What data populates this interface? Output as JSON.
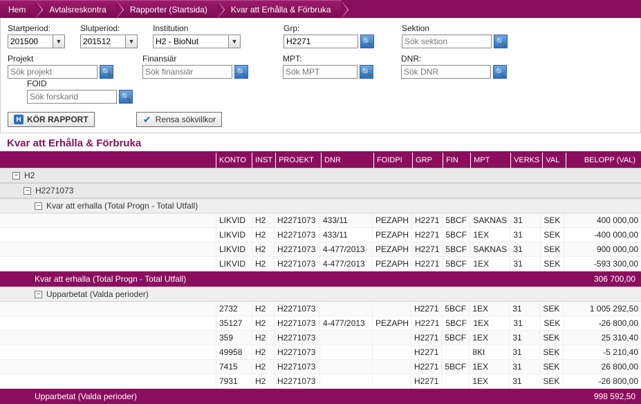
{
  "breadcrumb": [
    "Hem",
    "Avtalsreskontra",
    "Rapporter (Startsida)",
    "Kvar att Erhålla & Förbruka"
  ],
  "filters": {
    "startperiod": {
      "label": "Startperiod:",
      "value": "201500"
    },
    "slutperiod": {
      "label": "Slutperiod:",
      "value": "201512"
    },
    "institution": {
      "label": "Institution",
      "value": "H2 - BioNut"
    },
    "grp": {
      "label": "Grp:",
      "value": "H2271"
    },
    "sektion": {
      "label": "Sektion",
      "placeholder": "Sök sektion",
      "value": ""
    },
    "projekt": {
      "label": "Projekt",
      "placeholder": "Sök projekt",
      "value": ""
    },
    "finansiar": {
      "label": "Finansiär",
      "placeholder": "Sök finansiär",
      "value": ""
    },
    "mpt": {
      "label": "MPT:",
      "placeholder": "Sök MPT",
      "value": ""
    },
    "dnr": {
      "label": "DNR:",
      "placeholder": "Sök DNR",
      "value": ""
    },
    "foid": {
      "label": "FOID",
      "placeholder": "Sök forskarid",
      "value": ""
    }
  },
  "buttons": {
    "run": "KÖR RAPPORT",
    "clear": "Rensa sökvillkor"
  },
  "report_title": "Kvar att Erhålla & Förbruka",
  "columns": {
    "konto": "KONTO",
    "inst": "INST",
    "projekt": "PROJEKT",
    "dnr": "DNR",
    "foidpi": "FOIDPI",
    "grp": "GRP",
    "fin": "FIN",
    "mpt": "MPT",
    "verks": "VERKS",
    "val": "VAL",
    "belopp": "BELOPP (VAL)"
  },
  "groups": {
    "g0": "H2",
    "g1": "H2271073",
    "g2a": "Kvar att erhalla (Total Progn - Total Utfall)",
    "g2b": "Upparbetat (Valda perioder)"
  },
  "rows_erhalla": [
    {
      "konto": "LIKVID",
      "inst": "H2",
      "projekt": "H2271073",
      "dnr": "433/11",
      "foidpi": "PEZAPH",
      "grp": "H2271",
      "fin": "5BCF",
      "mpt": "SAKNAS",
      "verks": "31",
      "val": "SEK",
      "belopp": "400 000,00"
    },
    {
      "konto": "LIKVID",
      "inst": "H2",
      "projekt": "H2271073",
      "dnr": "433/11",
      "foidpi": "PEZAPH",
      "grp": "H2271",
      "fin": "5BCF",
      "mpt": "1EX",
      "verks": "31",
      "val": "SEK",
      "belopp": "-400 000,00"
    },
    {
      "konto": "LIKVID",
      "inst": "H2",
      "projekt": "H2271073",
      "dnr": "4-477/2013",
      "foidpi": "PEZAPH",
      "grp": "H2271",
      "fin": "5BCF",
      "mpt": "SAKNAS",
      "verks": "31",
      "val": "SEK",
      "belopp": "900 000,00"
    },
    {
      "konto": "LIKVID",
      "inst": "H2",
      "projekt": "H2271073",
      "dnr": "4-477/2013",
      "foidpi": "PEZAPH",
      "grp": "H2271",
      "fin": "5BCF",
      "mpt": "1EX",
      "verks": "31",
      "val": "SEK",
      "belopp": "-593 300,00"
    }
  ],
  "subtotal_erhalla": {
    "label": "Kvar att erhalla (Total Progn - Total Utfall)",
    "value": "306 700,00"
  },
  "rows_upparbetat": [
    {
      "konto": "2732",
      "inst": "H2",
      "projekt": "H2271073",
      "dnr": "",
      "foidpi": "",
      "grp": "H2271",
      "fin": "5BCF",
      "mpt": "1EX",
      "verks": "31",
      "val": "SEK",
      "belopp": "1 005 292,50"
    },
    {
      "konto": "35127",
      "inst": "H2",
      "projekt": "H2271073",
      "dnr": "4-477/2013",
      "foidpi": "PEZAPH",
      "grp": "H2271",
      "fin": "5BCF",
      "mpt": "1EX",
      "verks": "31",
      "val": "SEK",
      "belopp": "-26 800,00"
    },
    {
      "konto": "359",
      "inst": "H2",
      "projekt": "H2271073",
      "dnr": "",
      "foidpi": "",
      "grp": "H2271",
      "fin": "5BCF",
      "mpt": "1EX",
      "verks": "31",
      "val": "SEK",
      "belopp": "25 310,40"
    },
    {
      "konto": "49958",
      "inst": "H2",
      "projekt": "H2271073",
      "dnr": "",
      "foidpi": "",
      "grp": "H2271",
      "fin": "",
      "mpt": "8KI",
      "verks": "31",
      "val": "SEK",
      "belopp": "-5 210,40"
    },
    {
      "konto": "7415",
      "inst": "H2",
      "projekt": "H2271073",
      "dnr": "",
      "foidpi": "",
      "grp": "H2271",
      "fin": "5BCF",
      "mpt": "1EX",
      "verks": "31",
      "val": "SEK",
      "belopp": "26 800,00"
    },
    {
      "konto": "7931",
      "inst": "H2",
      "projekt": "H2271073",
      "dnr": "",
      "foidpi": "",
      "grp": "H2271",
      "fin": "",
      "mpt": "1EX",
      "verks": "31",
      "val": "SEK",
      "belopp": "-26 800,00"
    }
  ],
  "subtotal_upparbetat": {
    "label": "Upparbetat (Valda perioder)",
    "value": "998 592,50"
  }
}
